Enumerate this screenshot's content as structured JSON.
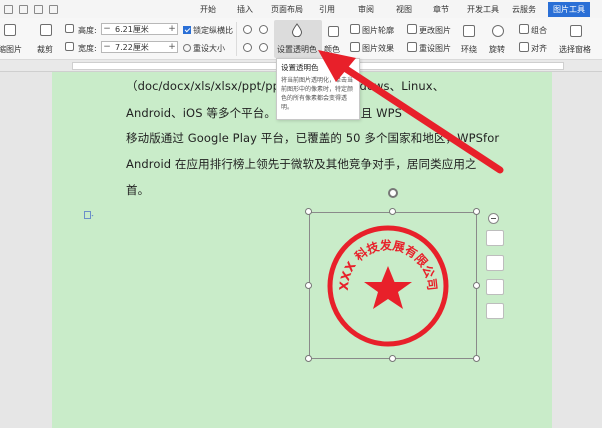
{
  "menu": {
    "tabs": [
      "开始",
      "插入",
      "页面布局",
      "引用",
      "审阅",
      "视图",
      "章节",
      "开发工具",
      "云服务",
      "图片工具"
    ],
    "active_tab": "图片工具"
  },
  "ribbon": {
    "compress_label": "缩图片",
    "crop_label": "裁剪",
    "height_label": "高度:",
    "height_value": "6.21厘米",
    "width_label": "宽度:",
    "width_value": "7.22厘米",
    "lock_ratio_label": "锁定纵横比",
    "reset_size_label": "重设大小",
    "set_transparent_label": "设置透明色",
    "color_label": "颜色",
    "outline_label": "图片轮廓",
    "effect_label": "图片效果",
    "change_picture_label": "更改图片",
    "reset_picture_label": "重设图片",
    "wrap_label": "环绕",
    "rotate_label": "旋转",
    "group_label": "组合",
    "align_label": "对齐",
    "select_pane_label": "选择窗格"
  },
  "tooltip": {
    "title": "设置透明色",
    "description": "将当前图片透明化，单击当前图形中的像素时，特定颜色的所有像素都会变得透明。"
  },
  "document": {
    "lines": [
      "（doc/docx/xls/xlsx/ppt/pptx 等     支持 Windows、Linux、",
      "Android、iOS 等多个平台。W                和移动办公。且 WPS",
      "移动版通过 Google Play 平台，已覆盖的 50 多个国家和地区，WPSfor",
      "Android 在应用排行榜上领先于微软及其他竞争对手，居同类应用之",
      "首。"
    ]
  },
  "stamp": {
    "text": "XXX 科技发展有限公司",
    "color": "#e8202a"
  },
  "colors": {
    "accent": "#2a6fd6",
    "page_bg": "#c9ecc9",
    "arrow": "#e8202a"
  }
}
